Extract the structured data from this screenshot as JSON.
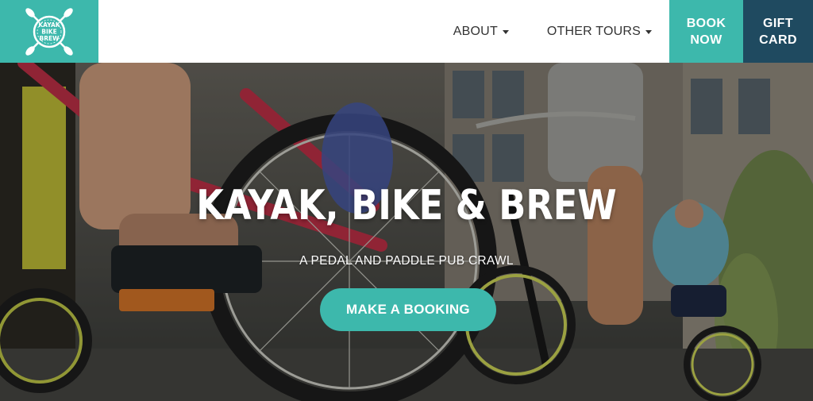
{
  "brand": {
    "logo_text": "KAYAK BIKE BREW",
    "accent_color": "#3db8ac",
    "dark_color": "#1f4a60"
  },
  "nav": {
    "items": [
      {
        "label": "ABOUT",
        "has_dropdown": true
      },
      {
        "label": "OTHER TOURS",
        "has_dropdown": true
      }
    ],
    "book_now": "BOOK\nNOW",
    "gift_card": "GIFT\nCARD"
  },
  "hero": {
    "title": "KAYAK, BIKE & BREW",
    "subtitle": "A PEDAL AND PADDLE PUB CRAWL",
    "cta_label": "MAKE A BOOKING",
    "background": "photo of people riding bicycles"
  }
}
